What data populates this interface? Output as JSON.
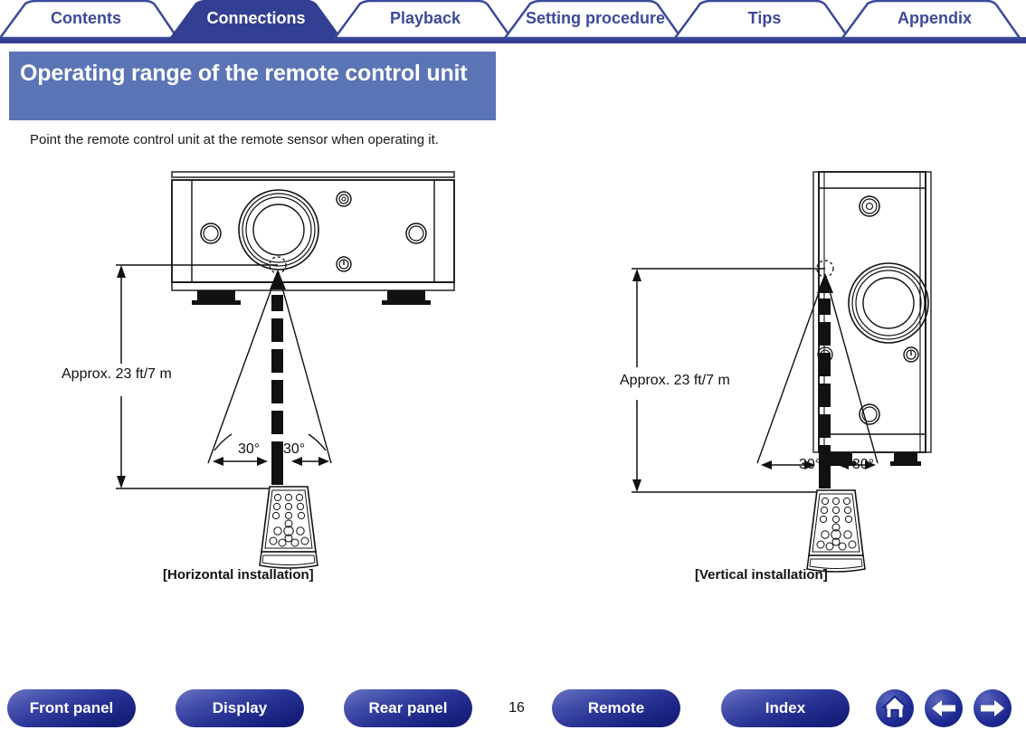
{
  "tabs": [
    {
      "label": "Contents",
      "active": false
    },
    {
      "label": "Connections",
      "active": true
    },
    {
      "label": "Playback",
      "active": false
    },
    {
      "label": "Setting procedure",
      "active": false
    },
    {
      "label": "Tips",
      "active": false
    },
    {
      "label": "Appendix",
      "active": false
    }
  ],
  "section": {
    "title": "Operating range of the remote control unit",
    "intro": "Point the remote control unit at the remote sensor when operating it."
  },
  "diagrams": {
    "horizontal": {
      "distance_label": "Approx. 23 ft/7 m",
      "angle_left": "30°",
      "angle_right": "30°",
      "caption": "[Horizontal installation]"
    },
    "vertical": {
      "distance_label": "Approx. 23 ft/7 m",
      "angle_left": "30°",
      "angle_right": "30°",
      "caption": "[Vertical installation]"
    }
  },
  "footer": {
    "buttons": [
      {
        "label": "Front panel"
      },
      {
        "label": "Display"
      },
      {
        "label": "Rear panel"
      },
      {
        "label": "Remote"
      },
      {
        "label": "Index"
      }
    ],
    "page_number": "16",
    "icons": [
      {
        "name": "home-icon"
      },
      {
        "name": "arrow-left-icon"
      },
      {
        "name": "arrow-right-icon"
      }
    ]
  },
  "colors": {
    "tab_accent": "#3c4a9a",
    "tab_active_bg": "#333f92",
    "title_bg": "#5b74b5",
    "pill_blue": "#2a3496",
    "line": "#111111"
  }
}
